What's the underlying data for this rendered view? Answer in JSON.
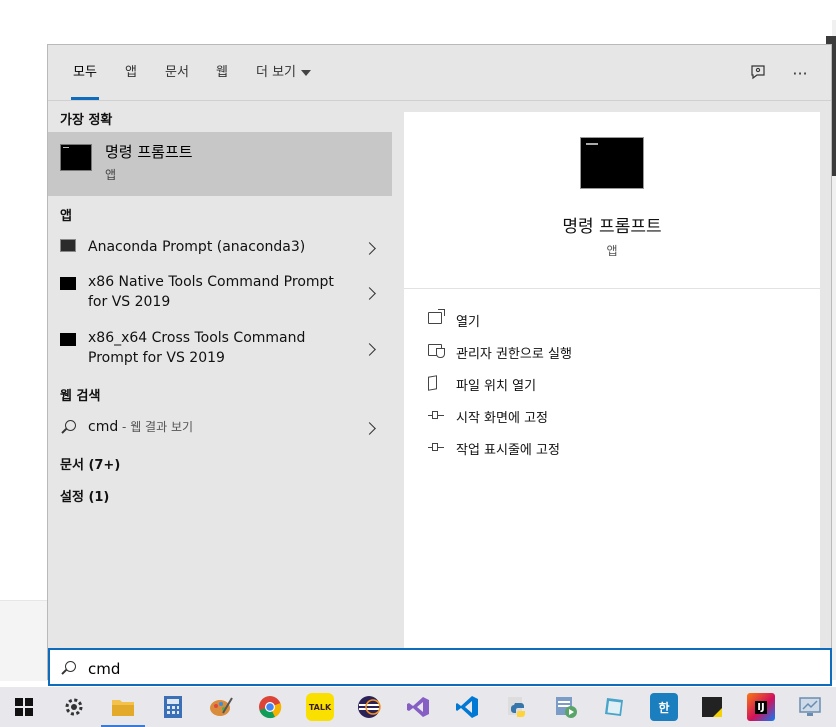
{
  "tabs": [
    {
      "label": "모두",
      "active": true
    },
    {
      "label": "앱"
    },
    {
      "label": "문서"
    },
    {
      "label": "웹"
    },
    {
      "label": "더 보기"
    }
  ],
  "header_icons": {
    "feedback": "feedback-icon",
    "more": "more-icon",
    "more_glyph": "···"
  },
  "best_match": {
    "section": "가장 정확",
    "title": "명령 프롬프트",
    "subtitle": "앱"
  },
  "apps": {
    "section": "앱",
    "items": [
      {
        "line1": "Anaconda Prompt (anaconda3)",
        "line2": ""
      },
      {
        "line1": "x86 Native Tools Command Prompt",
        "line2": "for VS 2019"
      },
      {
        "line1": "x86_x64 Cross Tools Command",
        "line2": "Prompt for VS 2019"
      }
    ]
  },
  "web": {
    "section": "웹 검색",
    "query": "cmd",
    "suffix": " - 웹 결과 보기"
  },
  "documents": {
    "label": "문서 (7+)"
  },
  "settings": {
    "label": "설정 (1)"
  },
  "detail": {
    "title": "명령 프롬프트",
    "subtitle": "앱",
    "actions": [
      {
        "label": "열기",
        "icon": "open-icon"
      },
      {
        "label": "관리자 권한으로 실행",
        "icon": "shield-icon"
      },
      {
        "label": "파일 위치 열기",
        "icon": "file-location-icon"
      },
      {
        "label": "시작 화면에 고정",
        "icon": "pin-icon"
      },
      {
        "label": "작업 표시줄에 고정",
        "icon": "pin-icon"
      }
    ]
  },
  "search": {
    "value": "cmd"
  },
  "taskbar": {
    "kakao_label": "TALK",
    "hwp_label": "한",
    "intellij_label": "IJ",
    "items": [
      {
        "name": "start",
        "color": "#111111"
      },
      {
        "name": "settings",
        "color": "#333333"
      },
      {
        "name": "file-explorer",
        "color": "#f2c14e"
      },
      {
        "name": "calculator",
        "color": "#3b6fb6"
      },
      {
        "name": "paint",
        "color": "#d98c3c"
      },
      {
        "name": "chrome",
        "color": "#db4437"
      },
      {
        "name": "kakaotalk",
        "color": "#f9e000"
      },
      {
        "name": "eclipse",
        "color": "#2c2255"
      },
      {
        "name": "visual-studio",
        "color": "#865fc5"
      },
      {
        "name": "vscode",
        "color": "#0078d4"
      },
      {
        "name": "python",
        "color": "#3776ab"
      },
      {
        "name": "task-scheduler",
        "color": "#5aa469"
      },
      {
        "name": "notepad",
        "color": "#4aa3c8"
      },
      {
        "name": "hwp",
        "color": "#1b7fbf"
      },
      {
        "name": "sticky-notes",
        "color": "#222222"
      },
      {
        "name": "intellij",
        "color": "#d0115c"
      },
      {
        "name": "remote-desktop",
        "color": "#6a8caf"
      }
    ]
  }
}
